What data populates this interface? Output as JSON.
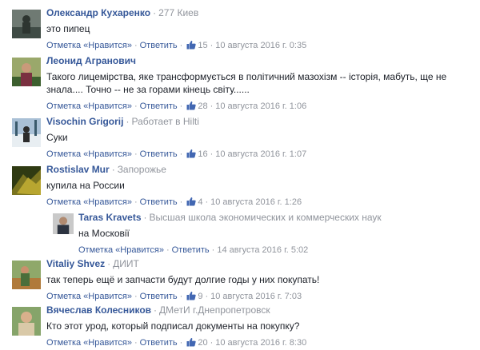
{
  "actions": {
    "reply": "Ответить",
    "like": "Отметка «Нравится»",
    "sep": "·"
  },
  "comments": [
    {
      "author": "Олександр Кухаренко",
      "meta": "277 Киев",
      "text": "это пипец",
      "likes": "15",
      "date": "10 августа 2016 г. 0:35",
      "avatar_colors": [
        "#6f7a73",
        "#3f4b45"
      ]
    },
    {
      "author": "Леонид Агранович",
      "meta": "",
      "text": "Такого лицемірства, яке трансформується в політичний мазохізм -- історія, мабуть, ще не знала.... Точно -- не за горами кінець світу......",
      "likes": "28",
      "date": "10 августа 2016 г. 1:06",
      "avatar_colors": [
        "#9aa86b",
        "#3c5f2e"
      ]
    },
    {
      "author": "Visochin Grigorij",
      "meta": "Работает в Hilti",
      "text": "Суки",
      "likes": "16",
      "date": "10 августа 2016 г. 1:07",
      "avatar_colors": [
        "#a9c0d6",
        "#3a5a6c"
      ]
    },
    {
      "author": "Rostislav Mur",
      "meta": "Запорожье",
      "text": "купила на России",
      "likes": "4",
      "date": "10 августа 2016 г. 1:26",
      "avatar_colors": [
        "#7a7420",
        "#2f3a12"
      ]
    },
    {
      "author": "Taras Kravets",
      "meta": "Высшая школа экономических и коммерческих наук",
      "text": "на Московії",
      "likes": "",
      "date": "14 августа 2016 г. 5:02",
      "avatar_colors": [
        "#c9c9c9",
        "#2c3340"
      ]
    },
    {
      "author": "Vitaliy Shvez",
      "meta": "ДИИТ",
      "text": "так теперь ещё и запчасти будут долгие годы у них покупать!",
      "likes": "9",
      "date": "10 августа 2016 г. 7:03",
      "avatar_colors": [
        "#8fa86a",
        "#b07a3b"
      ]
    },
    {
      "author": "Вячеслав Колесников",
      "meta": "ДМетИ г.Днепропетровск",
      "text": "Кто этот урод, который подписал документы на покупку?",
      "likes": "20",
      "date": "10 августа 2016 г. 8:30",
      "avatar_colors": [
        "#86a46a",
        "#d9c9a8"
      ]
    }
  ]
}
